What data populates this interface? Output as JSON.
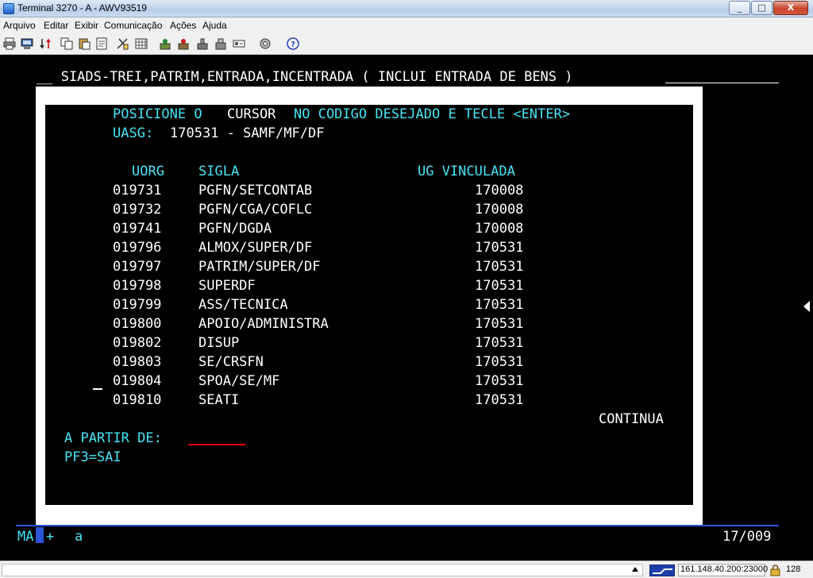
{
  "window": {
    "title": "Terminal 3270 - A - AWV93519",
    "minimize": "_",
    "maximize": "□",
    "close": "X"
  },
  "menu": [
    "Arquivo",
    "Editar",
    "Exibir",
    "Comunicação",
    "Ações",
    "Ajuda"
  ],
  "toolbar_icons": [
    "print-icon",
    "print-screen-icon",
    "transfer-icon",
    "copy-icon",
    "paste-icon",
    "cut-icon",
    "paste-special-icon",
    "keypad-icon",
    "macro-record-icon",
    "macro-stop-icon",
    "macro-play-icon",
    "send-icon",
    "properties-icon",
    "help-icon"
  ],
  "terminal": {
    "headline": "__ SIADS-TREI,PATRIM,ENTRADA,INCENTRADA ( INCLUI ENTRADA DE BENS )",
    "instruction": {
      "part1": "POSICIONE O",
      "part2": "CURSOR",
      "part3": "NO CODIGO DESEJADO E TECLE <ENTER>"
    },
    "uasg_label": "UASG:",
    "uasg_value": "170531 - SAMF/MF/DF",
    "columns": {
      "uorg": "UORG",
      "sigla": "SIGLA",
      "ug": "UG VINCULADA"
    },
    "rows": [
      {
        "uorg": "019731",
        "sigla": "PGFN/SETCONTAB",
        "ug": "170008"
      },
      {
        "uorg": "019732",
        "sigla": "PGFN/CGA/COFLC",
        "ug": "170008"
      },
      {
        "uorg": "019741",
        "sigla": "PGFN/DGDA",
        "ug": "170008"
      },
      {
        "uorg": "019796",
        "sigla": "ALMOX/SUPER/DF",
        "ug": "170531"
      },
      {
        "uorg": "019797",
        "sigla": "PATRIM/SUPER/DF",
        "ug": "170531"
      },
      {
        "uorg": "019798",
        "sigla": "SUPERDF",
        "ug": "170531"
      },
      {
        "uorg": "019799",
        "sigla": "ASS/TECNICA",
        "ug": "170531"
      },
      {
        "uorg": "019800",
        "sigla": "APOIO/ADMINISTRA",
        "ug": "170531"
      },
      {
        "uorg": "019802",
        "sigla": "DISUP",
        "ug": "170531"
      },
      {
        "uorg": "019803",
        "sigla": "SE/CRSFN",
        "ug": "170531"
      },
      {
        "uorg": "019804",
        "sigla": "SPOA/SE/MF",
        "ug": "170531"
      },
      {
        "uorg": "019810",
        "sigla": "SEATI",
        "ug": "170531"
      }
    ],
    "continua": "CONTINUA",
    "a_partir_label": "A PARTIR DE:",
    "pf3": "PF3=SAI",
    "oia_left": "MA",
    "oia_plus": "+",
    "oia_a": "a",
    "oia_cursor_pos": "17/009"
  },
  "status": {
    "host": "161.148.40.200:23000",
    "code": "128"
  }
}
